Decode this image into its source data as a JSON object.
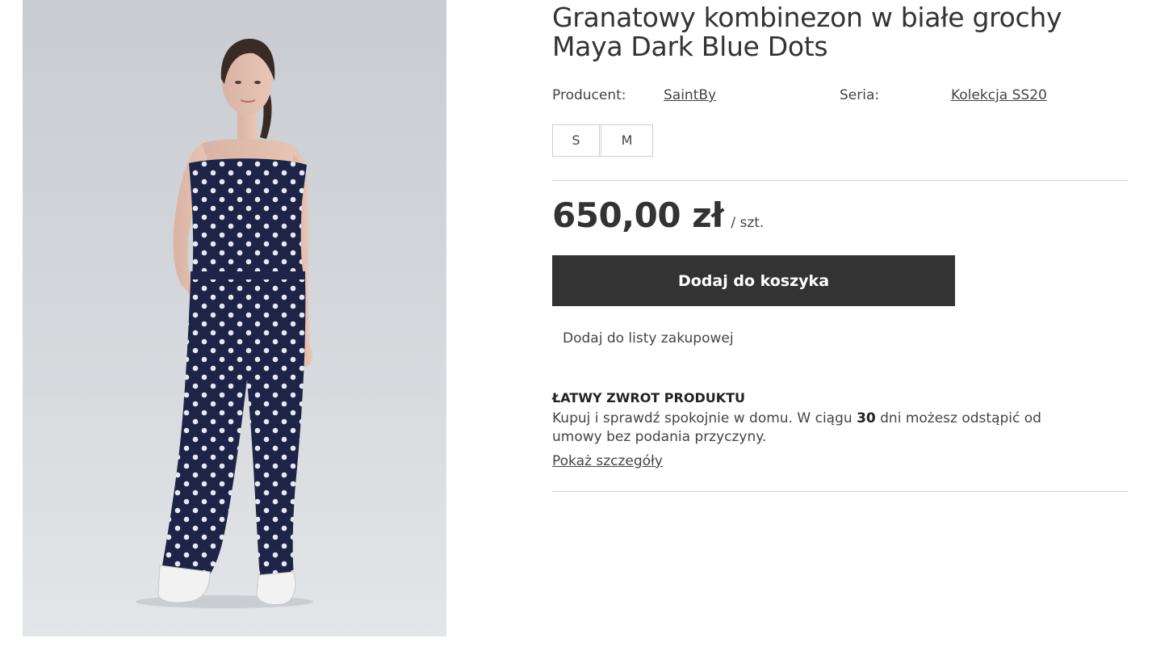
{
  "product": {
    "title_line1": "Granatowy kombinezon w białe grochy",
    "title_line2": "Maya Dark Blue Dots",
    "image_alt_icon": "product-photo",
    "producer_label": "Producent:",
    "producer_value": "SaintBy",
    "series_label": "Seria:",
    "series_value": "Kolekcja SS20",
    "sizes": [
      "S",
      "M"
    ],
    "price": "650,00 zł",
    "unit": "/ szt.",
    "add_to_cart_label": "Dodaj do koszyka",
    "add_to_list_label": "Dodaj do listy zakupowej"
  },
  "returns": {
    "heading": "ŁATWY ZWROT PRODUKTU",
    "text_before": "Kupuj i sprawdź spokojnie w domu. W ciągu ",
    "days": "30",
    "text_after": " dni możesz odstąpić od umowy bez podania przyczyny.",
    "details_link": "Pokaż szczegóły"
  },
  "colors": {
    "button_bg": "#333333",
    "jumpsuit": "#1d2447",
    "dots": "#e8e8ee",
    "background": "#d3d6da"
  }
}
